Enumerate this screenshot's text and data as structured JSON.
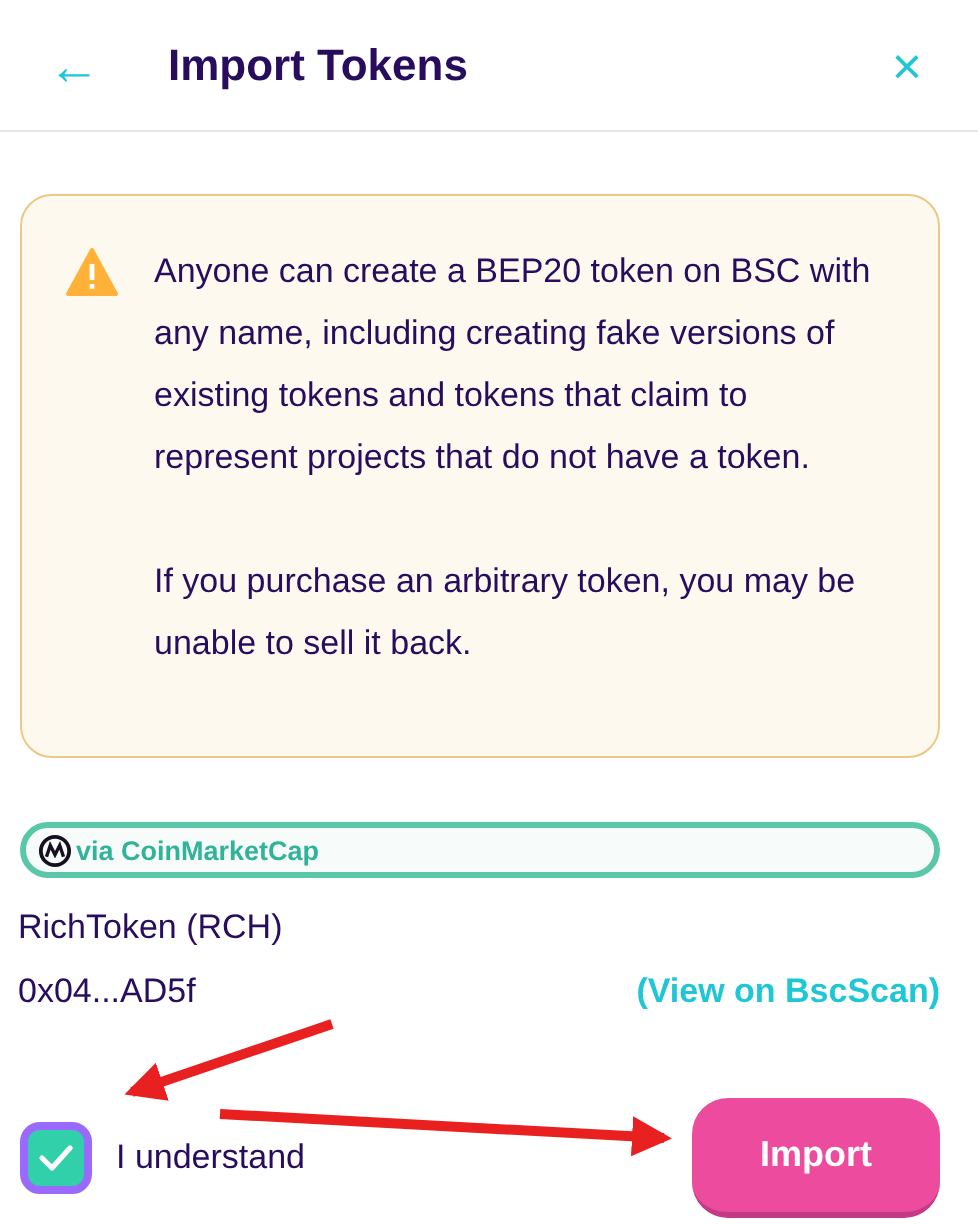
{
  "header": {
    "back": "←",
    "title": "Import Tokens",
    "close": "×"
  },
  "warning": {
    "paragraphs": [
      "Anyone can create a BEP20 token on BSC with any name, including creating fake versions of existing tokens and tokens that claim to represent projects that do not have a token.",
      "If you purchase an arbitrary token, you may be unable to sell it back."
    ]
  },
  "source_badge": {
    "label": "via CoinMarketCap"
  },
  "token": {
    "name": "RichToken  (RCH)",
    "address": "0x04...AD5f",
    "link": "(View on BscScan)"
  },
  "acknowledge": {
    "label": "I understand",
    "checked": true
  },
  "import_button": {
    "label": "Import"
  }
}
